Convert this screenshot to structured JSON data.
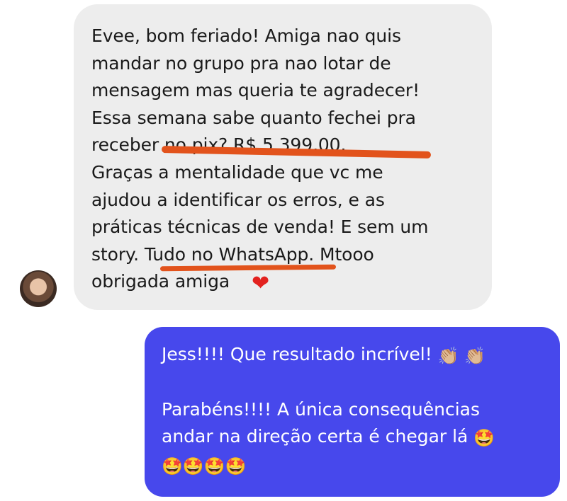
{
  "incoming": {
    "lines": [
      "Evee, bom feriado! Amiga nao quis",
      "mandar no grupo pra nao lotar de",
      "mensagem mas queria te agradecer!",
      "Essa semana sabe quanto fechei pra",
      "receber no pix? R$ 5.399,00.",
      "Graças a mentalidade que vc me",
      "ajudou a identificar os erros, e as",
      "práticas técnicas de venda! E sem um",
      "story. Tudo no WhatsApp. Mtooo",
      "obrigada amiga"
    ],
    "heart_emoji": "❤"
  },
  "outgoing": {
    "line1": "Jess!!!! Que resultado incrível!",
    "clap_emojis": "👏🏼 👏🏼",
    "line2": "Parabéns!!!! A única consequências",
    "line3": "andar na direção certa é chegar lá",
    "emoji_end": "🤩",
    "emoji_row": "🤩🤩🤩🤩"
  }
}
